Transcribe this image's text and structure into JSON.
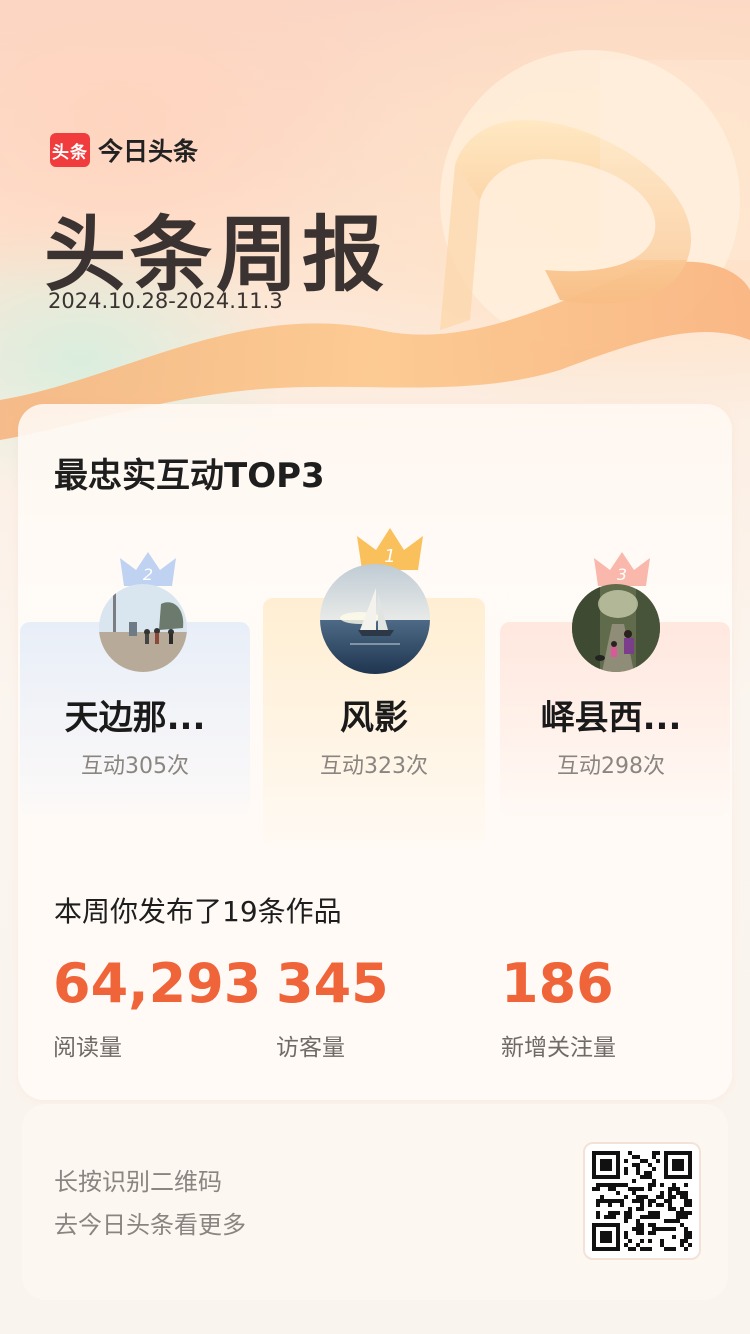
{
  "brand": {
    "logo_text": "头条",
    "app_name": "今日头条"
  },
  "hero": {
    "title": "头条周报",
    "date_range": "2024.10.28-2024.11.3"
  },
  "top_interactions": {
    "title": "最忠实互动TOP3",
    "ranks": [
      {
        "rank": "1",
        "name": "风影",
        "interactions": "互动323次"
      },
      {
        "rank": "2",
        "name": "天边那...",
        "interactions": "互动305次"
      },
      {
        "rank": "3",
        "name": "峄县西...",
        "interactions": "互动298次"
      }
    ]
  },
  "weekly_stats": {
    "summary": "本周你发布了19条作品",
    "items": [
      {
        "value": "64,293",
        "label": "阅读量"
      },
      {
        "value": "345",
        "label": "访客量"
      },
      {
        "value": "186",
        "label": "新增关注量"
      }
    ]
  },
  "qr": {
    "line1": "长按识别二维码",
    "line2": "去今日头条看更多"
  },
  "colors": {
    "accent": "#f0643a",
    "brand_red": "#f03c3c",
    "rank1_gold": "#f8b94a",
    "rank2_blue": "#a9c4f0",
    "rank3_coral": "#f7a898"
  },
  "icons": {
    "crown_rank1": "gold-crown-icon",
    "crown_rank2": "blue-crown-icon",
    "crown_rank3": "coral-crown-icon"
  }
}
